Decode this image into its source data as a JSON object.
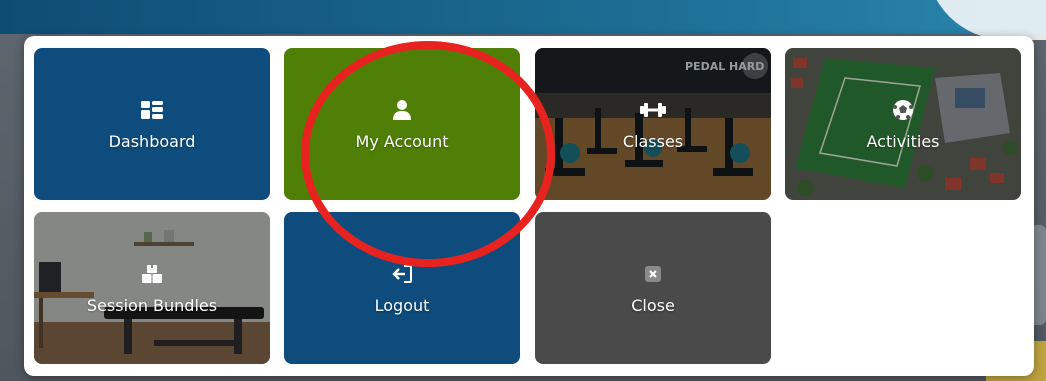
{
  "menu": {
    "tiles": [
      {
        "label": "Dashboard",
        "icon": "dashboard-icon"
      },
      {
        "label": "My Account",
        "icon": "user-icon"
      },
      {
        "label": "Classes",
        "icon": "dumbbell-icon"
      },
      {
        "label": "Activities",
        "icon": "football-icon"
      },
      {
        "label": "Session Bundles",
        "icon": "boxes-icon"
      },
      {
        "label": "Logout",
        "icon": "logout-icon"
      },
      {
        "label": "Close",
        "icon": "close-icon"
      }
    ]
  },
  "photos": {
    "classes_sign": "PEDAL HARD"
  },
  "colors": {
    "tile_blue": "#0e4c7d",
    "tile_green": "#4f7f06",
    "tile_grey": "#4a4a4a",
    "highlight_red": "#e8231f"
  }
}
